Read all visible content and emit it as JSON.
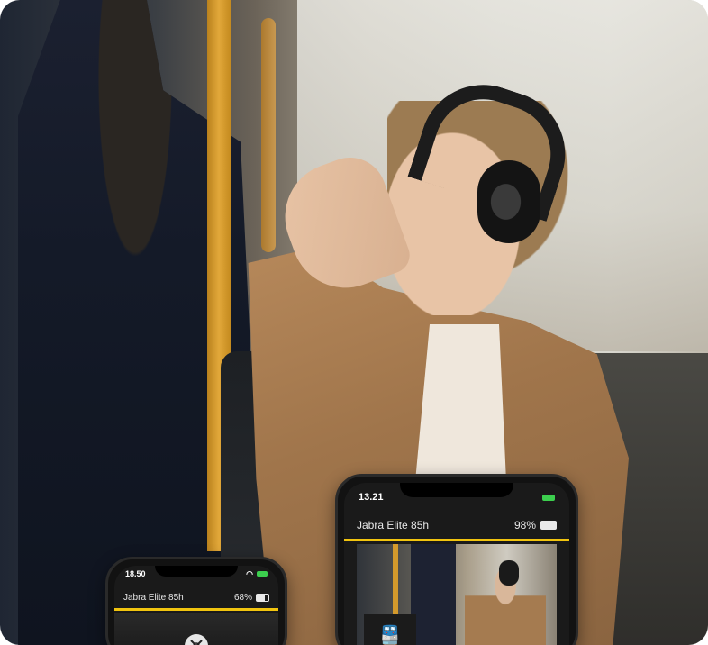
{
  "phone_small": {
    "time": "18.50",
    "device_name": "Jabra Elite 85h",
    "battery_percent": "68%",
    "battery_level": 0.68,
    "mode_icon": "crossed-tools-icon"
  },
  "phone_large": {
    "time": "13.21",
    "device_name": "Jabra Elite 85h",
    "battery_percent": "98%",
    "battery_level": 0.98,
    "mode_icon": "train-icon"
  },
  "colors": {
    "accent_yellow": "#f1c40f",
    "battery_green": "#3ccf4e"
  }
}
